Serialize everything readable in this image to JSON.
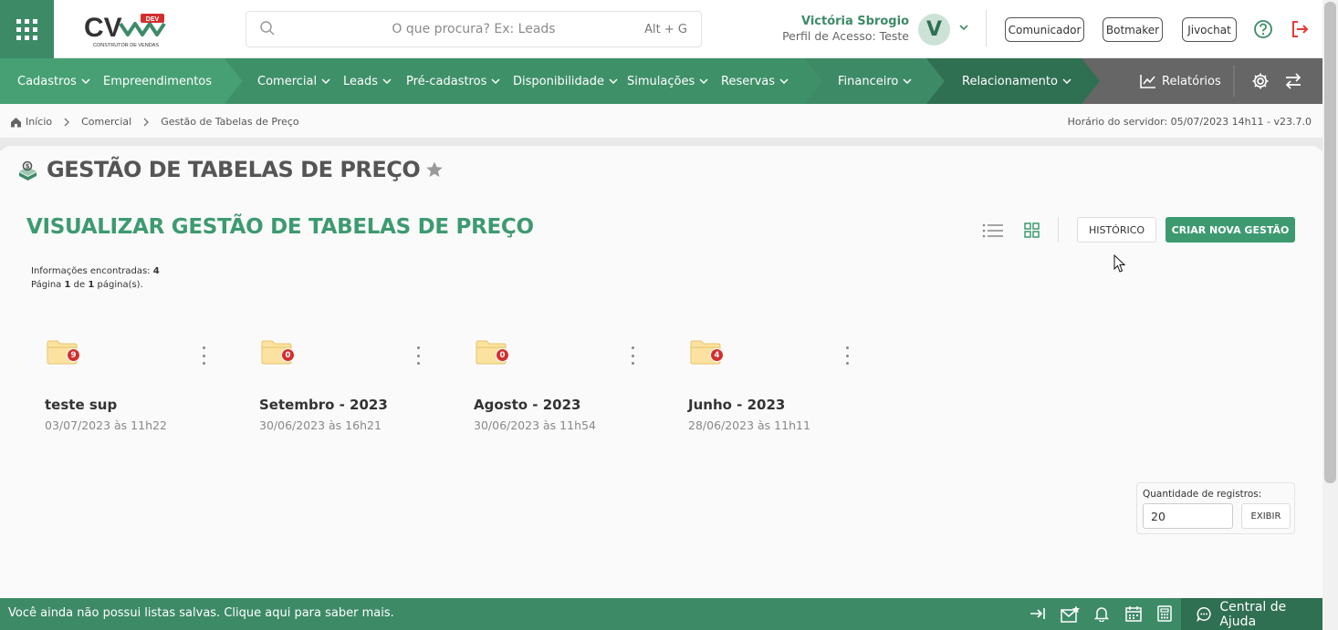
{
  "header": {
    "logo_text": "CV",
    "logo_badge": "DEV",
    "logo_tagline": "CONSTRUTOR DE VENDAS",
    "search_placeholder": "O que procura? Ex: Leads",
    "search_shortcut": "Alt + G",
    "user_name": "Victória Sbrogio",
    "user_role": "Perfil de Acesso: Teste",
    "avatar_letter": "V",
    "buttons": [
      "Comunicador",
      "Botmaker",
      "Jivochat"
    ],
    "brand_color": "#3d8a67"
  },
  "nav": {
    "items": [
      {
        "label": "Cadastros",
        "has_menu": true
      },
      {
        "label": "Empreendimentos",
        "has_menu": false
      },
      {
        "label": "Comercial",
        "has_menu": true
      },
      {
        "label": "Leads",
        "has_menu": true
      },
      {
        "label": "Pré-cadastros",
        "has_menu": true
      },
      {
        "label": "Disponibilidade",
        "has_menu": true
      },
      {
        "label": "Simulações",
        "has_menu": true
      },
      {
        "label": "Reservas",
        "has_menu": true
      },
      {
        "label": "Financeiro",
        "has_menu": true
      },
      {
        "label": "Relacionamento",
        "has_menu": true
      },
      {
        "label": "Relatórios",
        "has_menu": false
      }
    ]
  },
  "breadcrumb": {
    "items": [
      "Início",
      "Comercial",
      "Gestão de Tabelas de Preço"
    ],
    "server_time": "Horário do servidor: 05/07/2023 14h11 - v23.7.0"
  },
  "page": {
    "title": "GESTÃO DE TABELAS DE PREÇO",
    "subtitle": "VISUALIZAR GESTÃO DE TABELAS DE PREÇO",
    "history_button": "HISTÓRICO",
    "new_button": "CRIAR NOVA GESTÃO",
    "info_found_label": "Informações encontradas:",
    "info_found_count": "4",
    "page_word": "Página",
    "page_current": "1",
    "page_of": "de",
    "page_total": "1",
    "page_suffix": "página(s).",
    "accent_color": "#3d9a70"
  },
  "folders": [
    {
      "name": "teste sup",
      "date": "03/07/2023 às 11h22",
      "count": "9"
    },
    {
      "name": "Setembro - 2023",
      "date": "30/06/2023 às 16h21",
      "count": "0"
    },
    {
      "name": "Agosto - 2023",
      "date": "30/06/2023 às 11h54",
      "count": "0"
    },
    {
      "name": "Junho - 2023",
      "date": "28/06/2023 às 11h11",
      "count": "4"
    }
  ],
  "records": {
    "label": "Quantidade de registros:",
    "value": "20",
    "button": "EXIBIR"
  },
  "footer": {
    "message": "Você ainda não possui listas salvas. Clique aqui para saber mais.",
    "help_label": "Central de Ajuda",
    "icons": [
      "collapse-icon",
      "mail-star-icon",
      "bell-icon",
      "calendar-icon",
      "calculator-icon"
    ]
  }
}
